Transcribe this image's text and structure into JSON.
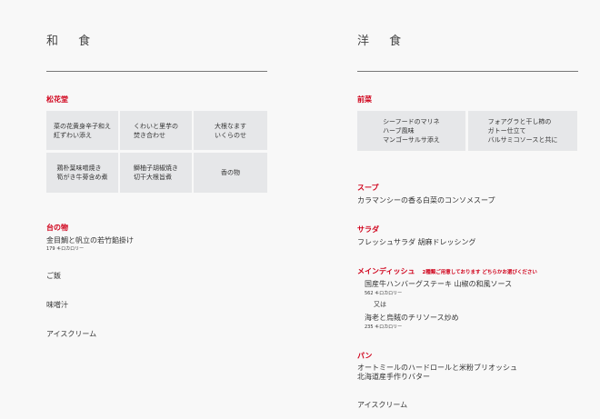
{
  "washoku": {
    "title": "和 食",
    "sections": {
      "shokado": {
        "label": "松花堂",
        "cells": [
          "菜の花黄身辛子和え\n紅ずわい添え",
          "くわいと里芋の\n焚き合わせ",
          "大根なます\nいくらのせ",
          "鶏朴葉味噌焼き\n筍がき牛蒡含め煮",
          "鰤柚子胡椒焼き\n切干大根旨煮",
          "香の物"
        ]
      },
      "dai": {
        "label": "台の物",
        "item": "金目鯛と帆立の若竹餡掛け",
        "kcal": "179 キロカロリー"
      },
      "rice": "ご飯",
      "miso": "味噌汁",
      "dessert": "アイスクリーム"
    }
  },
  "yoshoku": {
    "title": "洋 食",
    "sections": {
      "zensai": {
        "label": "前菜",
        "cells": [
          "シーフードのマリネ\nハーブ風味\nマンゴーサルサ添え",
          "フォアグラと干し柿の\nガトー仕立て\nバルサミコソースと共に"
        ]
      },
      "soup": {
        "label": "スープ",
        "item": "カラマンシーの香る白菜のコンソメスープ"
      },
      "salad": {
        "label": "サラダ",
        "item": "フレッシュサラダ 胡麻ドレッシング"
      },
      "main": {
        "label": "メインディッシュ",
        "note": "2種類ご用意しております どちらかお選びください",
        "items": [
          {
            "name": "国産牛ハンバーグステーキ 山椒の和風ソース",
            "kcal": "562 キロカロリー"
          },
          {
            "name": "海老と烏賊のチリソース炒め",
            "kcal": "235 キロカロリー"
          }
        ],
        "or": "又は"
      },
      "bread": {
        "label": "パン",
        "line1": "オートミールのハードロールと米粉ブリオッシュ",
        "line2": "北海道産手作りバター"
      },
      "dessert": "アイスクリーム"
    }
  },
  "colors": {
    "accent": "#d0021b"
  }
}
